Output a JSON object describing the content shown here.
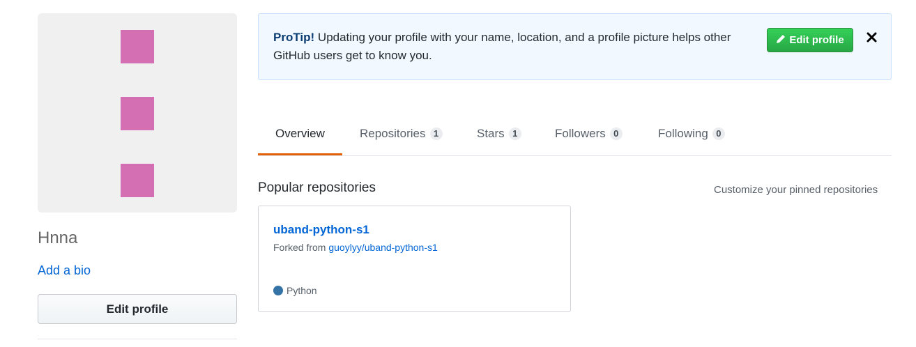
{
  "profile": {
    "name": "Hnna",
    "add_bio": "Add a bio",
    "edit_profile": "Edit profile",
    "avatar_color": "#d46fb3"
  },
  "protip": {
    "label": "ProTip!",
    "text": " Updating your profile with your name, location, and a profile picture helps other GitHub users get to know you.",
    "edit_button": "Edit profile",
    "close_icon": "close-icon"
  },
  "tabs": [
    {
      "label": "Overview",
      "count": null,
      "selected": true
    },
    {
      "label": "Repositories",
      "count": "1"
    },
    {
      "label": "Stars",
      "count": "1"
    },
    {
      "label": "Followers",
      "count": "0"
    },
    {
      "label": "Following",
      "count": "0"
    }
  ],
  "popular": {
    "title": "Popular repositories",
    "customize": "Customize your pinned repositories",
    "repos": [
      {
        "name": "uband-python-s1",
        "forked_prefix": "Forked from ",
        "forked_from": "guoylyy/uband-python-s1",
        "language": "Python",
        "language_color": "#3572A5"
      }
    ]
  },
  "colors": {
    "accent_underline": "#e36209",
    "link": "#0366d6",
    "primary_button": "#28a745"
  }
}
